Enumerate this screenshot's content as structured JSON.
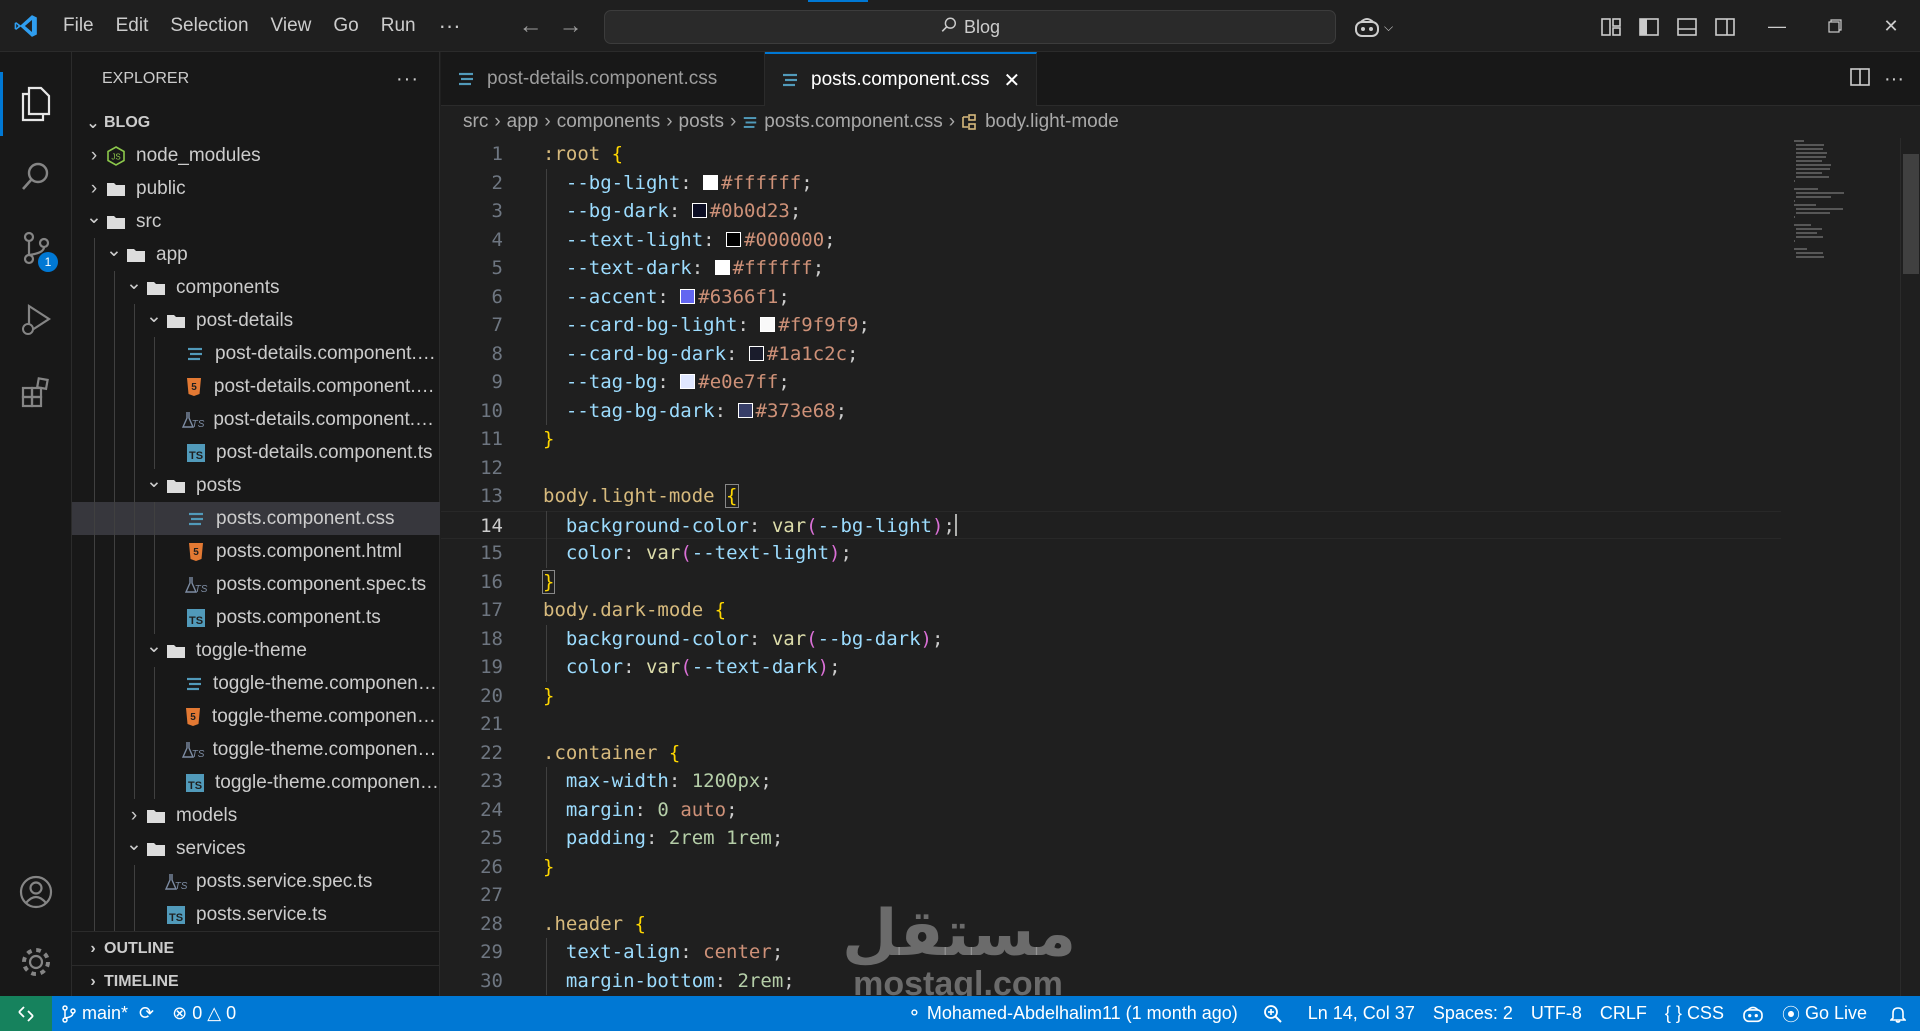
{
  "menu": {
    "items": [
      "File",
      "Edit",
      "Selection",
      "View",
      "Go",
      "Run"
    ],
    "more": "···"
  },
  "search": {
    "text": "Blog",
    "icon": "search-icon"
  },
  "window_controls": [
    "minimize-icon",
    "restore-icon",
    "close-icon"
  ],
  "activity_bar": {
    "items": [
      "files-icon",
      "search-icon",
      "source-control-icon",
      "run-debug-icon",
      "extensions-icon"
    ],
    "scm_badge": "1",
    "bottom": [
      "account-icon",
      "settings-gear-icon"
    ]
  },
  "explorer": {
    "title": "EXPLORER",
    "more": "···",
    "root": "BLOG",
    "tree": [
      {
        "label": "node_modules",
        "type": "folder-node",
        "depth": 0,
        "expanded": false
      },
      {
        "label": "public",
        "type": "folder",
        "depth": 0,
        "expanded": false
      },
      {
        "label": "src",
        "type": "folder",
        "depth": 0,
        "expanded": true
      },
      {
        "label": "app",
        "type": "folder",
        "depth": 1,
        "expanded": true
      },
      {
        "label": "components",
        "type": "folder",
        "depth": 2,
        "expanded": true
      },
      {
        "label": "post-details",
        "type": "folder",
        "depth": 3,
        "expanded": true
      },
      {
        "label": "post-details.component.css",
        "type": "css",
        "depth": 4
      },
      {
        "label": "post-details.component.html",
        "type": "html",
        "depth": 4
      },
      {
        "label": "post-details.component.spec.ts",
        "type": "spec",
        "depth": 4
      },
      {
        "label": "post-details.component.ts",
        "type": "ts",
        "depth": 4
      },
      {
        "label": "posts",
        "type": "folder",
        "depth": 3,
        "expanded": true
      },
      {
        "label": "posts.component.css",
        "type": "css",
        "depth": 4,
        "selected": true
      },
      {
        "label": "posts.component.html",
        "type": "html",
        "depth": 4
      },
      {
        "label": "posts.component.spec.ts",
        "type": "spec",
        "depth": 4
      },
      {
        "label": "posts.component.ts",
        "type": "ts",
        "depth": 4
      },
      {
        "label": "toggle-theme",
        "type": "folder",
        "depth": 3,
        "expanded": true
      },
      {
        "label": "toggle-theme.component.css",
        "type": "css",
        "depth": 4
      },
      {
        "label": "toggle-theme.component.html",
        "type": "html",
        "depth": 4
      },
      {
        "label": "toggle-theme.component.spec.ts",
        "type": "spec",
        "depth": 4
      },
      {
        "label": "toggle-theme.component.ts",
        "type": "ts",
        "depth": 4
      },
      {
        "label": "models",
        "type": "folder",
        "depth": 2,
        "expanded": false
      },
      {
        "label": "services",
        "type": "folder",
        "depth": 2,
        "expanded": true
      },
      {
        "label": "posts.service.spec.ts",
        "type": "spec",
        "depth": 3
      },
      {
        "label": "posts.service.ts",
        "type": "ts",
        "depth": 3
      }
    ],
    "outline": "OUTLINE",
    "timeline": "TIMELINE"
  },
  "tabs": [
    {
      "label": "post-details.component.css",
      "active": false
    },
    {
      "label": "posts.component.css",
      "active": true
    }
  ],
  "breadcrumb": [
    "src",
    "app",
    "components",
    "posts",
    "posts.component.css",
    "body.light-mode"
  ],
  "code": {
    "current_line": 14,
    "lines": [
      [
        [
          "t-sel",
          ":root"
        ],
        [
          "t-pun",
          " "
        ],
        [
          "t-b1",
          "{"
        ]
      ],
      [
        [
          "t-pun",
          "  "
        ],
        [
          "t-prop",
          "--bg-light"
        ],
        [
          "t-pun",
          ": "
        ],
        [
          "swatch",
          "#ffffff"
        ],
        [
          "t-val",
          "#ffffff"
        ],
        [
          "t-pun",
          ";"
        ]
      ],
      [
        [
          "t-pun",
          "  "
        ],
        [
          "t-prop",
          "--bg-dark"
        ],
        [
          "t-pun",
          ": "
        ],
        [
          "swatch",
          "#0b0d23"
        ],
        [
          "t-val",
          "#0b0d23"
        ],
        [
          "t-pun",
          ";"
        ]
      ],
      [
        [
          "t-pun",
          "  "
        ],
        [
          "t-prop",
          "--text-light"
        ],
        [
          "t-pun",
          ": "
        ],
        [
          "swatch",
          "#000000"
        ],
        [
          "t-val",
          "#000000"
        ],
        [
          "t-pun",
          ";"
        ]
      ],
      [
        [
          "t-pun",
          "  "
        ],
        [
          "t-prop",
          "--text-dark"
        ],
        [
          "t-pun",
          ": "
        ],
        [
          "swatch",
          "#ffffff"
        ],
        [
          "t-val",
          "#ffffff"
        ],
        [
          "t-pun",
          ";"
        ]
      ],
      [
        [
          "t-pun",
          "  "
        ],
        [
          "t-prop",
          "--accent"
        ],
        [
          "t-pun",
          ": "
        ],
        [
          "swatch",
          "#6366f1"
        ],
        [
          "t-val",
          "#6366f1"
        ],
        [
          "t-pun",
          ";"
        ]
      ],
      [
        [
          "t-pun",
          "  "
        ],
        [
          "t-prop",
          "--card-bg-light"
        ],
        [
          "t-pun",
          ": "
        ],
        [
          "swatch",
          "#f9f9f9"
        ],
        [
          "t-val",
          "#f9f9f9"
        ],
        [
          "t-pun",
          ";"
        ]
      ],
      [
        [
          "t-pun",
          "  "
        ],
        [
          "t-prop",
          "--card-bg-dark"
        ],
        [
          "t-pun",
          ": "
        ],
        [
          "swatch",
          "#1a1c2c"
        ],
        [
          "t-val",
          "#1a1c2c"
        ],
        [
          "t-pun",
          ";"
        ]
      ],
      [
        [
          "t-pun",
          "  "
        ],
        [
          "t-prop",
          "--tag-bg"
        ],
        [
          "t-pun",
          ": "
        ],
        [
          "swatch",
          "#e0e7ff"
        ],
        [
          "t-val",
          "#e0e7ff"
        ],
        [
          "t-pun",
          ";"
        ]
      ],
      [
        [
          "t-pun",
          "  "
        ],
        [
          "t-prop",
          "--tag-bg-dark"
        ],
        [
          "t-pun",
          ": "
        ],
        [
          "swatch",
          "#373e68"
        ],
        [
          "t-val",
          "#373e68"
        ],
        [
          "t-pun",
          ";"
        ]
      ],
      [
        [
          "t-b1",
          "}"
        ]
      ],
      [],
      [
        [
          "t-sel",
          "body.light-mode"
        ],
        [
          "t-pun",
          " "
        ],
        [
          "t-b1 bracket-box",
          "{"
        ]
      ],
      [
        [
          "t-pun",
          "  "
        ],
        [
          "t-prop",
          "background-color"
        ],
        [
          "t-pun",
          ": "
        ],
        [
          "t-fn",
          "var"
        ],
        [
          "t-b2",
          "("
        ],
        [
          "t-prop",
          "--bg-light"
        ],
        [
          "t-b2",
          ")"
        ],
        [
          "t-pun",
          ";"
        ],
        [
          "cursor",
          ""
        ]
      ],
      [
        [
          "t-pun",
          "  "
        ],
        [
          "t-prop",
          "color"
        ],
        [
          "t-pun",
          ": "
        ],
        [
          "t-fn",
          "var"
        ],
        [
          "t-b2",
          "("
        ],
        [
          "t-prop",
          "--text-light"
        ],
        [
          "t-b2",
          ")"
        ],
        [
          "t-pun",
          ";"
        ]
      ],
      [
        [
          "t-b1 bracket-box",
          "}"
        ]
      ],
      [
        [
          "t-sel",
          "body.dark-mode"
        ],
        [
          "t-pun",
          " "
        ],
        [
          "t-b1",
          "{"
        ]
      ],
      [
        [
          "t-pun",
          "  "
        ],
        [
          "t-prop",
          "background-color"
        ],
        [
          "t-pun",
          ": "
        ],
        [
          "t-fn",
          "var"
        ],
        [
          "t-b2",
          "("
        ],
        [
          "t-prop",
          "--bg-dark"
        ],
        [
          "t-b2",
          ")"
        ],
        [
          "t-pun",
          ";"
        ]
      ],
      [
        [
          "t-pun",
          "  "
        ],
        [
          "t-prop",
          "color"
        ],
        [
          "t-pun",
          ": "
        ],
        [
          "t-fn",
          "var"
        ],
        [
          "t-b2",
          "("
        ],
        [
          "t-prop",
          "--text-dark"
        ],
        [
          "t-b2",
          ")"
        ],
        [
          "t-pun",
          ";"
        ]
      ],
      [
        [
          "t-b1",
          "}"
        ]
      ],
      [],
      [
        [
          "t-sel",
          ".container"
        ],
        [
          "t-pun",
          " "
        ],
        [
          "t-b1",
          "{"
        ]
      ],
      [
        [
          "t-pun",
          "  "
        ],
        [
          "t-prop",
          "max-width"
        ],
        [
          "t-pun",
          ": "
        ],
        [
          "t-num",
          "1200px"
        ],
        [
          "t-pun",
          ";"
        ]
      ],
      [
        [
          "t-pun",
          "  "
        ],
        [
          "t-prop",
          "margin"
        ],
        [
          "t-pun",
          ": "
        ],
        [
          "t-num",
          "0"
        ],
        [
          "t-pun",
          " "
        ],
        [
          "t-val",
          "auto"
        ],
        [
          "t-pun",
          ";"
        ]
      ],
      [
        [
          "t-pun",
          "  "
        ],
        [
          "t-prop",
          "padding"
        ],
        [
          "t-pun",
          ": "
        ],
        [
          "t-num",
          "2rem"
        ],
        [
          "t-pun",
          " "
        ],
        [
          "t-num",
          "1rem"
        ],
        [
          "t-pun",
          ";"
        ]
      ],
      [
        [
          "t-b1",
          "}"
        ]
      ],
      [],
      [
        [
          "t-sel",
          ".header"
        ],
        [
          "t-pun",
          " "
        ],
        [
          "t-b1",
          "{"
        ]
      ],
      [
        [
          "t-pun",
          "  "
        ],
        [
          "t-prop",
          "text-align"
        ],
        [
          "t-pun",
          ": "
        ],
        [
          "t-val",
          "center"
        ],
        [
          "t-pun",
          ";"
        ]
      ],
      [
        [
          "t-pun",
          "  "
        ],
        [
          "t-prop",
          "margin-bottom"
        ],
        [
          "t-pun",
          ": "
        ],
        [
          "t-num",
          "2rem"
        ],
        [
          "t-pun",
          ";"
        ]
      ]
    ]
  },
  "watermark": {
    "arabic": "مستقل",
    "latin": "mostaql.com"
  },
  "statusbar": {
    "branch": "main*",
    "errors": "0",
    "warnings": "0",
    "author": "Mohamed-Abdelhalim11 (1 month ago)",
    "position": "Ln 14, Col 37",
    "spaces": "Spaces: 2",
    "encoding": "UTF-8",
    "eol": "CRLF",
    "language": "CSS",
    "golive": "Go Live"
  },
  "colors": {
    "accent": "#0078d4",
    "remote": "#16825d",
    "selected_row": "#37373d"
  }
}
